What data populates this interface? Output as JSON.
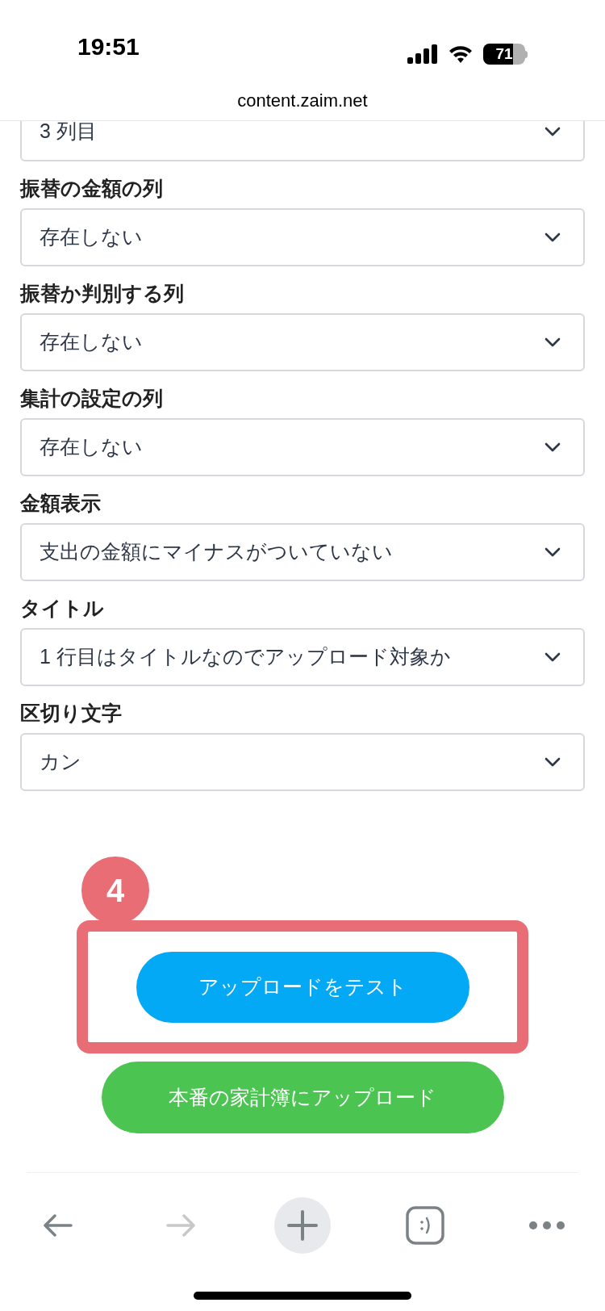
{
  "status_bar": {
    "time": "19:51",
    "battery": "71"
  },
  "address_bar": {
    "url": "content.zaim.net"
  },
  "fields": [
    {
      "value": "3 列目"
    },
    {
      "label": "振替の金額の列",
      "value": "存在しない"
    },
    {
      "label": "振替か判別する列",
      "value": "存在しない"
    },
    {
      "label": "集計の設定の列",
      "value": "存在しない"
    },
    {
      "label": "金額表示",
      "value": "支出の金額にマイナスがついていない"
    },
    {
      "label": "タイトル",
      "value": "1 行目はタイトルなのでアップロード対象か"
    },
    {
      "label": "区切り文字",
      "value": "カン"
    }
  ],
  "callout": {
    "number": "4"
  },
  "buttons": [
    {
      "label": "アップロードをテスト",
      "kind": "test",
      "highlighted": true
    },
    {
      "label": "本番の家計簿にアップロード",
      "kind": "upload",
      "highlighted": false
    }
  ],
  "toolbar": [
    {
      "kind": "back",
      "disabled": false
    },
    {
      "kind": "forward",
      "disabled": true
    },
    {
      "kind": "new",
      "disabled": false
    },
    {
      "kind": "tabs",
      "disabled": false
    },
    {
      "kind": "more",
      "disabled": false
    }
  ]
}
